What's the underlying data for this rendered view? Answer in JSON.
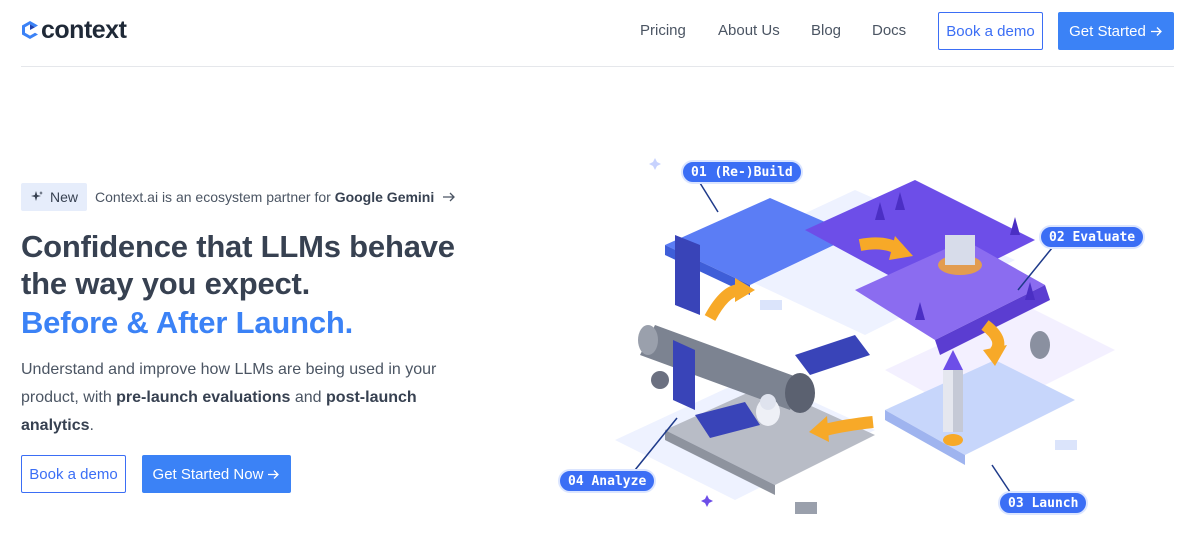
{
  "brand": {
    "name": "context"
  },
  "nav": {
    "links": [
      "Pricing",
      "About Us",
      "Blog",
      "Docs"
    ],
    "book_demo": "Book a demo",
    "get_started": "Get Started"
  },
  "announcement": {
    "badge": "New",
    "text": "Context.ai is an ecosystem partner for ",
    "highlight": "Google Gemini"
  },
  "hero": {
    "headline_line1": "Confidence that LLMs behave",
    "headline_line2": "the way you expect.",
    "headline_accent": "Before & After Launch.",
    "desc_part1": "Understand and improve how LLMs are being used in your product, with ",
    "desc_bold1": "pre-launch evaluations",
    "desc_part2": " and ",
    "desc_bold2": "post-launch analytics",
    "desc_part3": ".",
    "book_demo": "Book a demo",
    "get_started": "Get Started Now"
  },
  "illustration": {
    "stages": [
      "01 (Re-)Build",
      "02 Evaluate",
      "03 Launch",
      "04 Analyze"
    ]
  },
  "colors": {
    "accent": "#3b82f6",
    "accent_dark": "#3b6ef5",
    "purple": "#6d4ee8",
    "orange": "#f7a928"
  }
}
